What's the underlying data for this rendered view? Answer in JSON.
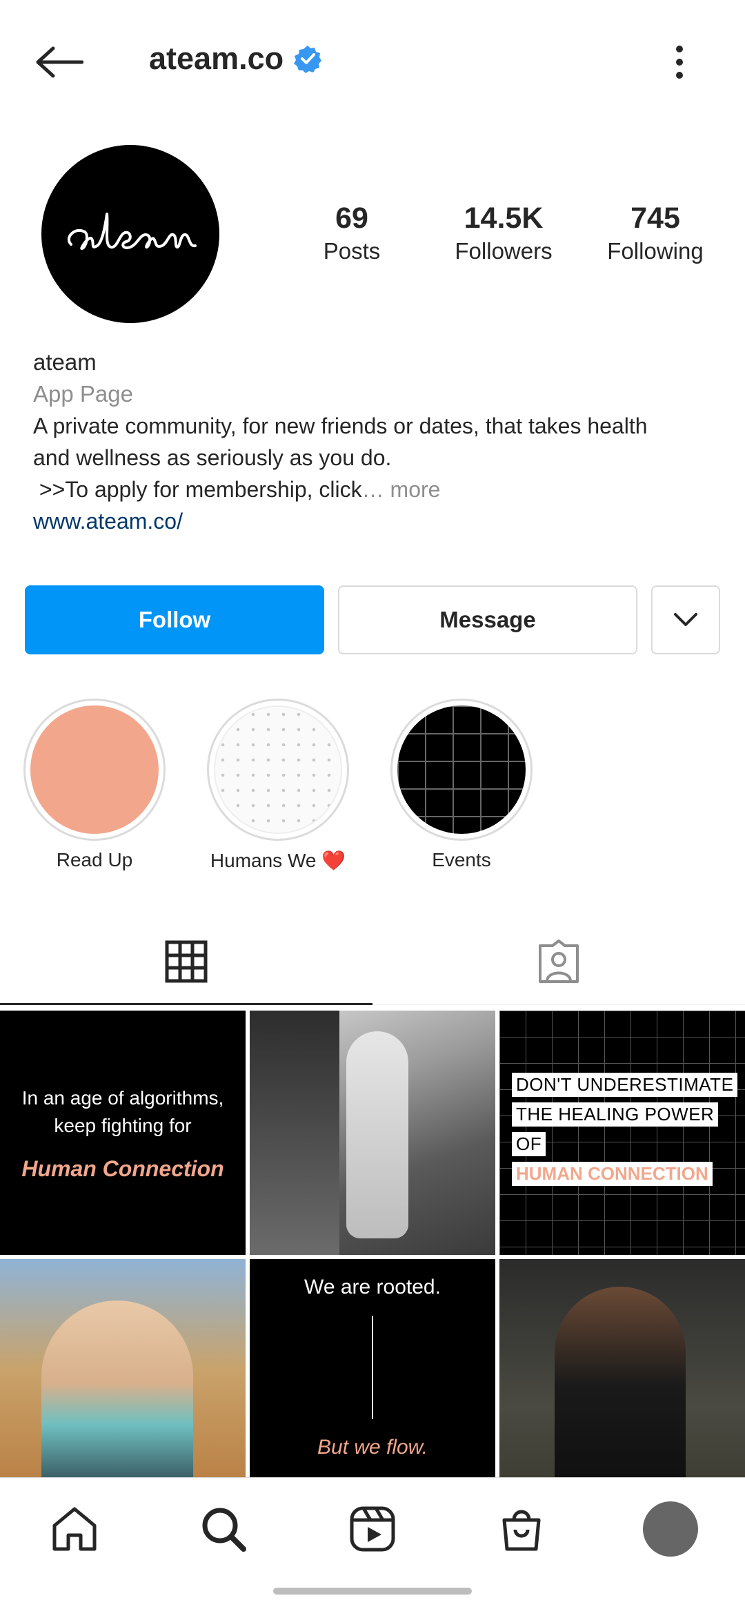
{
  "header": {
    "username": "ateam.co",
    "verified_icon": "verified-badge-icon",
    "accent_color": "#3897f0"
  },
  "profile": {
    "avatar_text": "ateam",
    "stats": [
      {
        "value": "69",
        "label": "Posts"
      },
      {
        "value": "14.5K",
        "label": "Followers"
      },
      {
        "value": "745",
        "label": "Following"
      }
    ],
    "name": "ateam",
    "category": "App Page",
    "bio_line1": "A private community, for new friends or dates, that takes health",
    "bio_line2": "and wellness as seriously as you do.",
    "bio_line3": " >>To apply for membership, click",
    "bio_more": "… more",
    "link": "www.ateam.co/"
  },
  "actions": {
    "follow_label": "Follow",
    "message_label": "Message",
    "follow_color": "#0095f6"
  },
  "highlights": [
    {
      "label": "Read Up"
    },
    {
      "label": "Humans We ❤️"
    },
    {
      "label": "Events"
    }
  ],
  "posts": {
    "post1": {
      "line": "In an age of algorithms, keep fighting for",
      "accent": "Human Connection"
    },
    "post3": {
      "tag1": "DON'T UNDERESTIMATE",
      "tag2": "THE HEALING POWER",
      "tag3": "OF",
      "tag4": "HUMAN CONNECTION"
    },
    "post5": {
      "top": "We are rooted.",
      "bottom": "But we flow."
    },
    "accent_color": "#f2a78c"
  }
}
